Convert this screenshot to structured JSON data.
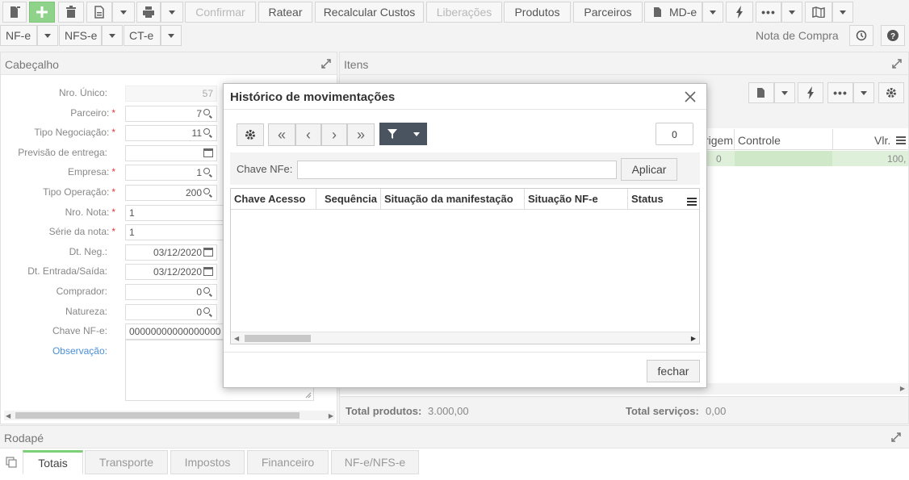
{
  "toolbar": {
    "confirm_label": "Confirmar",
    "ratear_label": "Ratear",
    "recalc_label": "Recalcular Custos",
    "liberacoes_label": "Liberações",
    "produtos_label": "Produtos",
    "parceiros_label": "Parceiros",
    "mde_label": "MD-e"
  },
  "doc_tabs": {
    "nfe": "NF-e",
    "nfse": "NFS-e",
    "cte": "CT-e",
    "context_title": "Nota de Compra"
  },
  "header_panel": {
    "title": "Cabeçalho",
    "fields": [
      {
        "label": "Nro. Único:",
        "value": "57",
        "required": false
      },
      {
        "label": "Parceiro:",
        "value": "7",
        "required": true
      },
      {
        "label": "Tipo Negociação:",
        "value": "11",
        "required": true
      },
      {
        "label": "Previsão de entrega:",
        "value": "",
        "required": false
      },
      {
        "label": "Empresa:",
        "value": "1",
        "required": true
      },
      {
        "label": "Tipo Operação:",
        "value": "200",
        "required": true
      },
      {
        "label": "Nro. Nota:",
        "value": "1",
        "required": true
      },
      {
        "label": "Série da nota:",
        "value": "1",
        "required": true
      },
      {
        "label": "Dt. Neg.:",
        "value": "03/12/2020",
        "required": false
      },
      {
        "label": "Dt. Entrada/Saída:",
        "value": "03/12/2020",
        "required": false
      },
      {
        "label": "Comprador:",
        "value": "0",
        "required": false
      },
      {
        "label": "Natureza:",
        "value": "0",
        "required": false
      },
      {
        "label": "Chave NF-e:",
        "value": "00000000000000000",
        "required": false
      },
      {
        "label": "Observação:",
        "value": "",
        "required": false
      }
    ]
  },
  "items_panel": {
    "title": "Itens",
    "col_origem": "rigem",
    "col_controle": "Controle",
    "col_vlr": "Vlr.",
    "row_origem": "0",
    "row_vlr": "100,",
    "total_produtos_label": "Total produtos:",
    "total_produtos_value": "3.000,00",
    "total_servicos_label": "Total serviços:",
    "total_servicos_value": "0,00"
  },
  "modal": {
    "title": "Histórico de movimentações",
    "count": "0",
    "filter_label": "Chave NFe:",
    "filter_value": "",
    "apply_label": "Aplicar",
    "columns": [
      "Chave Acesso",
      "Sequência",
      "Situação da manifestação",
      "Situação NF-e",
      "Status"
    ],
    "close_label": "fechar"
  },
  "footer": {
    "title": "Rodapé",
    "tabs": [
      "Totais",
      "Transporte",
      "Impostos",
      "Financeiro",
      "NF-e/NFS-e"
    ]
  },
  "colors": {
    "accent_green": "#7ccf77",
    "required": "#e53935",
    "link": "#4a8fd8",
    "dark_button": "#4a5460"
  }
}
